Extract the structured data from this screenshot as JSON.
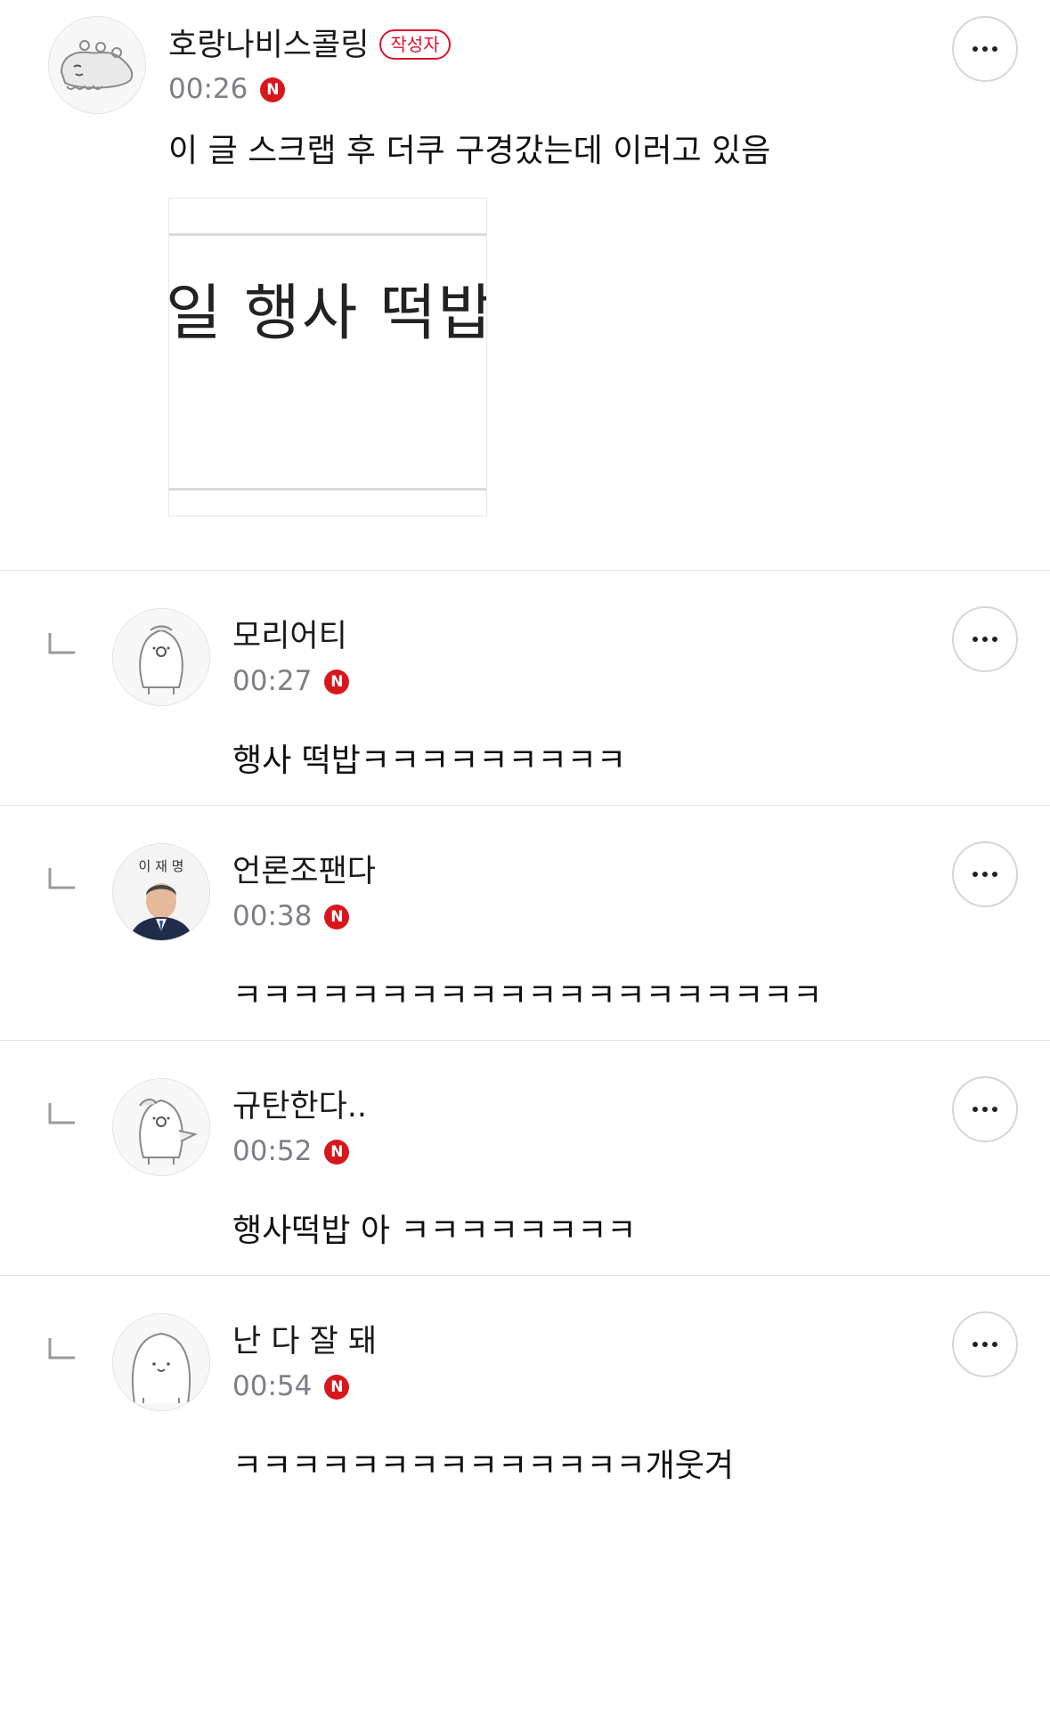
{
  "comments": [
    {
      "author": "호랑나비스콜링",
      "author_badge": "작성자",
      "time": "00:26",
      "new_badge": "N",
      "text": "이 글 스크랩 후 더쿠 구경갔는데 이러고 있음",
      "attachment_text": "일 행사 떡밥",
      "avatar_icon": "dinosaur-avatar-icon"
    },
    {
      "author": "모리어티",
      "time": "00:27",
      "new_badge": "N",
      "text": "행사 떡밥ㅋㅋㅋㅋㅋㅋㅋㅋㅋ",
      "avatar_icon": "penguin-avatar-icon"
    },
    {
      "author": "언론조팬다",
      "time": "00:38",
      "new_badge": "N",
      "text": "ㅋㅋㅋㅋㅋㅋㅋㅋㅋㅋㅋㅋㅋㅋㅋㅋㅋㅋㅋㅋ",
      "avatar_icon": "portrait-avatar-icon",
      "avatar_caption": "이 재 명"
    },
    {
      "author": "규탄한다..",
      "time": "00:52",
      "new_badge": "N",
      "text": "행사떡밥 아 ㅋㅋㅋㅋㅋㅋㅋㅋ",
      "avatar_icon": "penguin-waving-avatar-icon"
    },
    {
      "author": "난 다 잘 돼",
      "time": "00:54",
      "new_badge": "N",
      "text": "ㅋㅋㅋㅋㅋㅋㅋㅋㅋㅋㅋㅋㅋㅋ개웃겨",
      "avatar_icon": "seal-avatar-icon"
    }
  ],
  "colors": {
    "accent_red": "#d8171d",
    "time_gray": "#7d7f86",
    "divider": "#e3e3e3"
  }
}
